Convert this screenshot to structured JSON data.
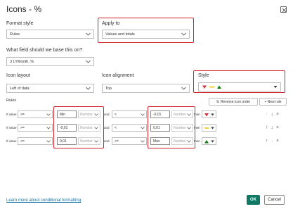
{
  "dialog": {
    "title": "Icons - %",
    "format_style_label": "Format style",
    "format_style_value": "Rules",
    "apply_to_label": "Apply to",
    "apply_to_value": "Values and totals",
    "field_label": "What field should we base this on?",
    "field_value": "3 LYMonth, %",
    "icon_layout_label": "Icon layout",
    "icon_layout_value": "Left of data",
    "icon_alignment_label": "Icon alignment",
    "icon_alignment_value": "Top",
    "style_label": "Style",
    "rules_label": "Rules",
    "reverse_label": "Reverse icon order",
    "new_rule_label": "+ New rule",
    "learn_more": "Learn more about conditional formatting",
    "ok": "OK",
    "cancel": "Cancel"
  },
  "rules": [
    {
      "if_label": "If value",
      "op1": ">=",
      "val1": "Min",
      "type1": "Number",
      "and_label": "and",
      "op2": "<",
      "val2": "-0,01",
      "type2": "Number",
      "then_label": "then",
      "icon": "red-down-triangle"
    },
    {
      "if_label": "If value",
      "op1": ">=",
      "val1": "-0,01",
      "type1": "Number",
      "and_label": "and",
      "op2": "<",
      "val2": "0,01",
      "type2": "Number",
      "then_label": "then",
      "icon": "yellow-dash"
    },
    {
      "if_label": "If value",
      "op1": ">=",
      "val1": "0,01",
      "type1": "Number",
      "and_label": "and",
      "op2": "<=",
      "val2": "Max",
      "type2": "Number",
      "then_label": "then",
      "icon": "green-up-triangle"
    }
  ],
  "colors": {
    "highlight": "#d3212c",
    "ok_button": "#117865",
    "link": "#1170a6",
    "icon_red": "#d13438",
    "icon_yellow": "#f2c80f",
    "icon_green": "#107c10"
  }
}
